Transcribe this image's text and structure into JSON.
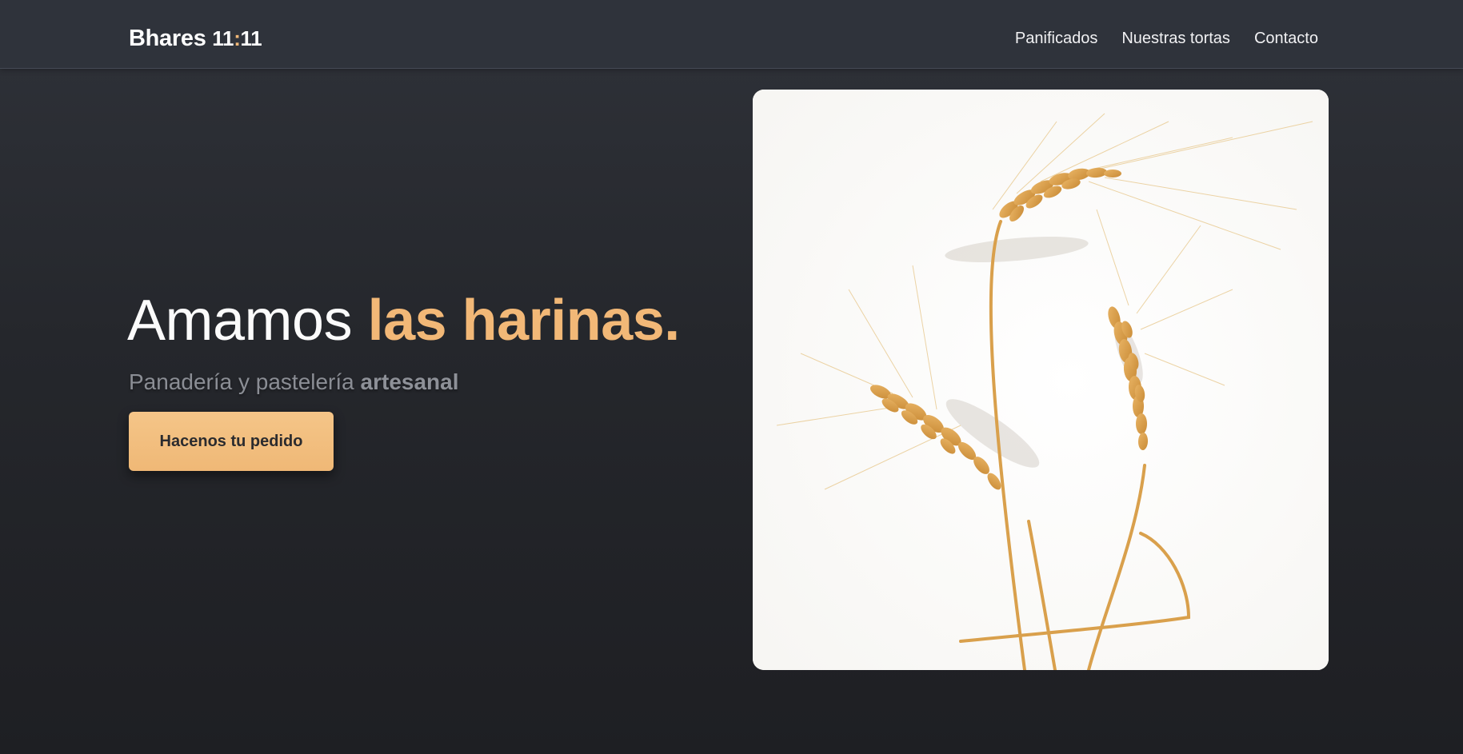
{
  "brand": {
    "name": "Bhares",
    "num_a": "11",
    "colon": ":",
    "num_b": "11"
  },
  "nav": {
    "items": [
      {
        "label": "Panificados"
      },
      {
        "label": "Nuestras tortas"
      },
      {
        "label": "Contacto"
      }
    ]
  },
  "hero": {
    "title_light": "Amamos",
    "title_accent": "las harinas.",
    "subtitle_light": "Panadería y pastelería",
    "subtitle_bold": "artesanal",
    "cta_label": "Hacenos tu pedido",
    "image_alt": "wheat-ears-photo"
  },
  "colors": {
    "accent": "#f2b877",
    "navbar": "#2f333b",
    "background": "#1e1f23"
  }
}
